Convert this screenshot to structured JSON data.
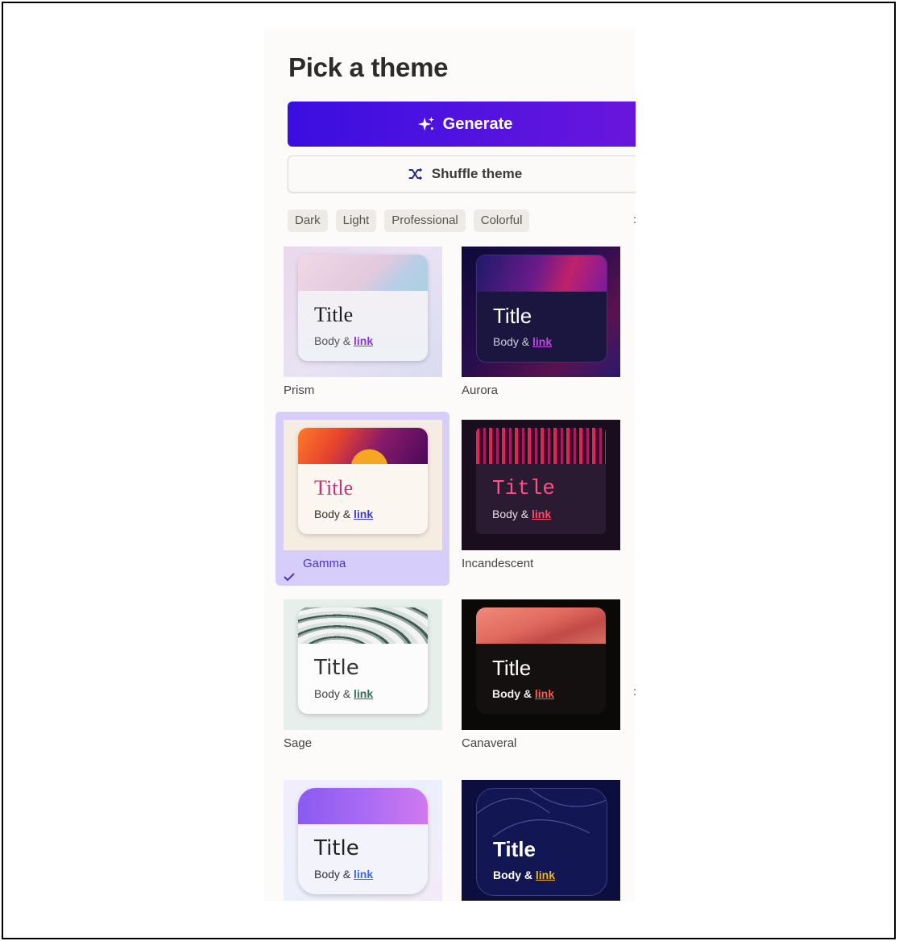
{
  "panel": {
    "heading": "Pick a theme",
    "generate_label": "Generate",
    "shuffle_label": "Shuffle theme",
    "filters": [
      "Dark",
      "Light",
      "Professional",
      "Colorful"
    ]
  },
  "sample": {
    "title": "Title",
    "body": "Body &",
    "link": "link"
  },
  "themes": [
    {
      "name": "Prism",
      "selected": false
    },
    {
      "name": "Aurora",
      "selected": false
    },
    {
      "name": "Gamma",
      "selected": true
    },
    {
      "name": "Incandescent",
      "selected": false
    },
    {
      "name": "Sage",
      "selected": false
    },
    {
      "name": "Canaveral",
      "selected": false
    },
    {
      "name": "",
      "selected": false
    },
    {
      "name": "",
      "selected": false
    }
  ],
  "colors": {
    "accent": "#4c12e0",
    "selected_bg": "#d7cdfb"
  },
  "icons": {
    "generate": "sparkle-icon",
    "shuffle": "shuffle-icon",
    "selected": "check-icon"
  }
}
